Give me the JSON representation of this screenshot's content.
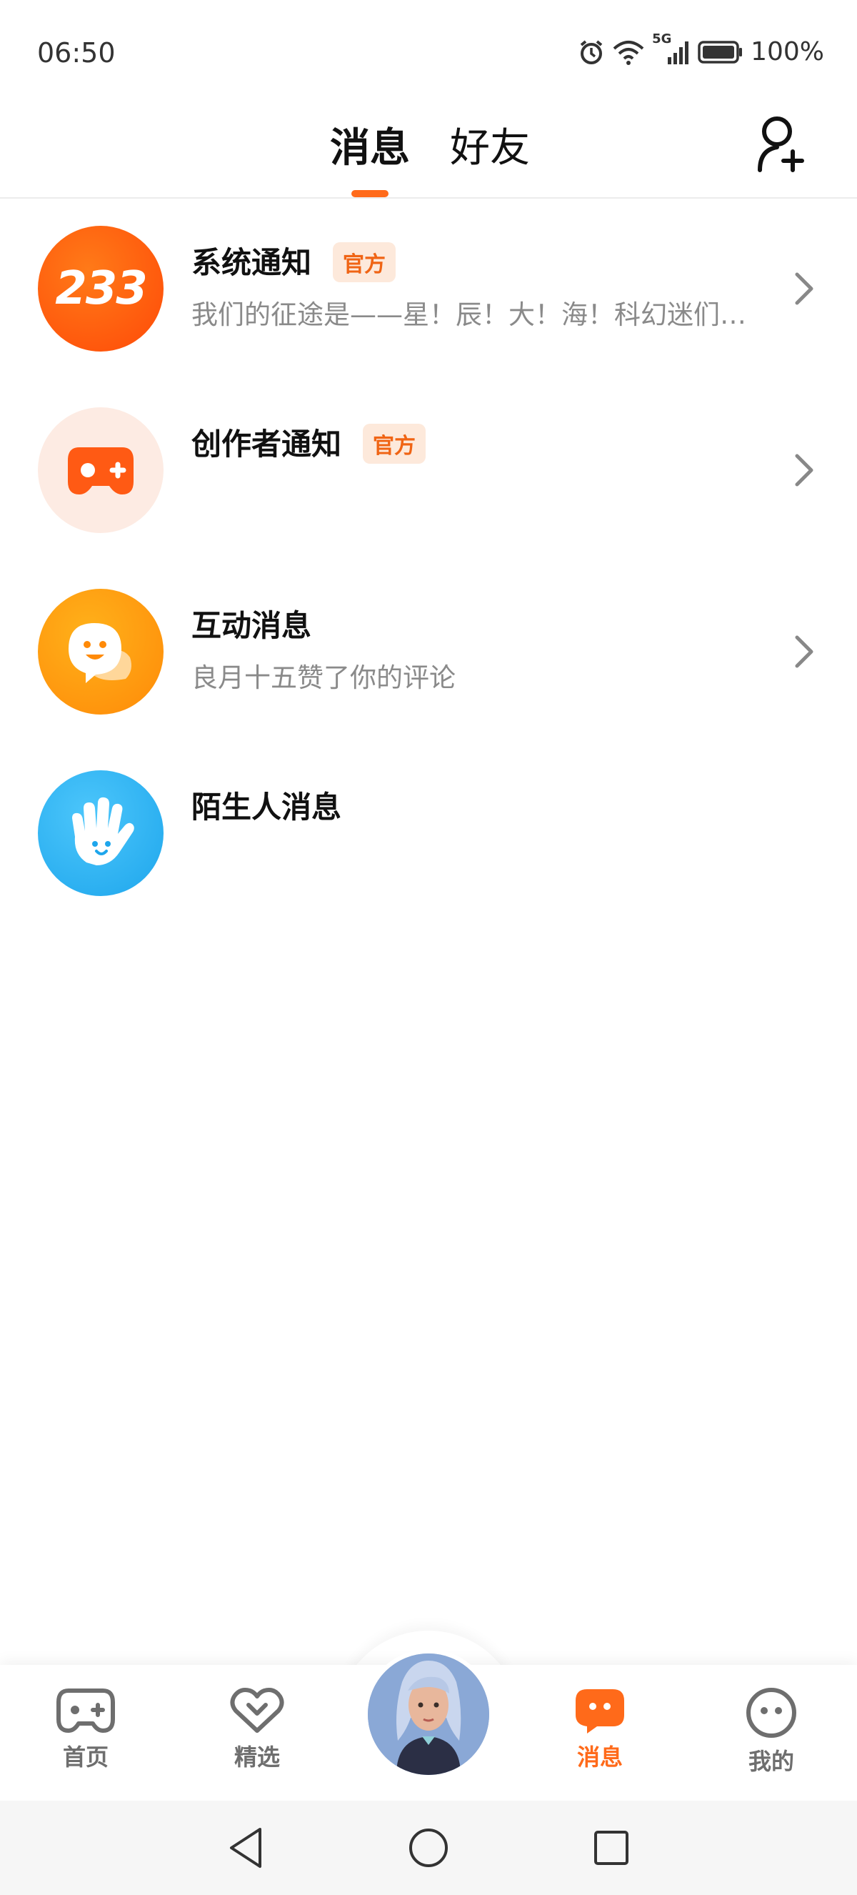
{
  "status_bar": {
    "time": "06:50",
    "network": "5G",
    "battery": "100%"
  },
  "header": {
    "tabs": [
      {
        "label": "消息",
        "active": true
      },
      {
        "label": "好友",
        "active": false
      }
    ],
    "add_friend_icon": "add-user-icon"
  },
  "messages": [
    {
      "title": "系统通知",
      "badge": "官方",
      "subtitle": "我们的征途是——星！辰！大！海！科幻迷们…",
      "avatar_text": "233",
      "avatar_color": "#ff5410",
      "has_chevron": true
    },
    {
      "title": "创作者通知",
      "badge": "官方",
      "subtitle": "",
      "avatar_icon": "gamepad-icon",
      "avatar_color": "#fdebe3",
      "has_chevron": true
    },
    {
      "title": "互动消息",
      "badge": "",
      "subtitle": "良月十五赞了你的评论",
      "avatar_icon": "chat-bubble-icon",
      "avatar_color": "#ff9a10",
      "has_chevron": true
    },
    {
      "title": "陌生人消息",
      "badge": "",
      "subtitle": "",
      "avatar_icon": "waving-hand-icon",
      "avatar_color": "#32b4f4",
      "has_chevron": false
    }
  ],
  "bottom_nav": {
    "items": [
      {
        "label": "首页",
        "icon": "gamepad-icon",
        "active": false
      },
      {
        "label": "精选",
        "icon": "heart-chevron-icon",
        "active": false
      },
      {
        "label": "",
        "icon": "character-avatar",
        "active": false
      },
      {
        "label": "消息",
        "icon": "message-icon",
        "active": true
      },
      {
        "label": "我的",
        "icon": "face-icon",
        "active": false
      }
    ]
  },
  "colors": {
    "accent": "#ff6a1a",
    "text_primary": "#111111",
    "text_secondary": "#8a8a8a",
    "badge_bg": "#fde9db"
  }
}
